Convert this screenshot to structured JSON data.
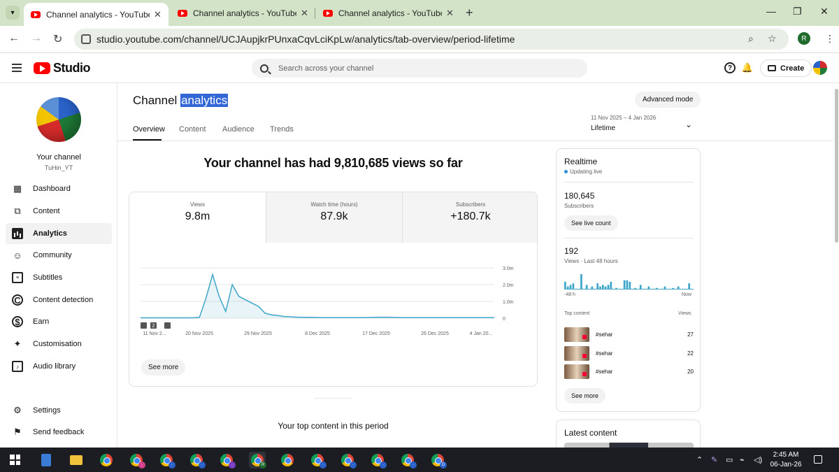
{
  "browser": {
    "tabs": [
      {
        "title": "Channel analytics - YouTube Studio",
        "active": true
      },
      {
        "title": "Channel analytics - YouTube Studio",
        "active": false
      },
      {
        "title": "Channel analytics - YouTube Studio",
        "active": false
      }
    ],
    "url": "studio.youtube.com/channel/UCJAupjkrPUnxaCqvLciKpLw/analytics/tab-overview/period-lifetime",
    "profile_initial": "R"
  },
  "header": {
    "logo_text": "Studio",
    "search_placeholder": "Search across your channel",
    "create_label": "Create"
  },
  "sidebar": {
    "channel_title": "Your channel",
    "channel_handle": "TuHin_YT",
    "items": [
      {
        "label": "Dashboard",
        "icon": "dashboard-icon"
      },
      {
        "label": "Content",
        "icon": "content-icon"
      },
      {
        "label": "Analytics",
        "icon": "analytics-icon",
        "active": true
      },
      {
        "label": "Community",
        "icon": "community-icon"
      },
      {
        "label": "Subtitles",
        "icon": "subtitles-icon"
      },
      {
        "label": "Content detection",
        "icon": "copyright-icon"
      },
      {
        "label": "Earn",
        "icon": "dollar-icon"
      },
      {
        "label": "Customisation",
        "icon": "magic-wand-icon"
      },
      {
        "label": "Audio library",
        "icon": "audio-library-icon"
      }
    ],
    "settings_label": "Settings",
    "feedback_label": "Send feedback"
  },
  "page": {
    "title_prefix": "Channel",
    "title_highlight": "analytics",
    "tabs": [
      "Overview",
      "Content",
      "Audience",
      "Trends"
    ],
    "advanced_mode_label": "Advanced mode",
    "date_range": "11 Nov 2025 – 4 Jan 2026",
    "period_label": "Lifetime",
    "headline": "Your channel has had 9,810,685 views so far",
    "metrics": [
      {
        "label": "Views",
        "value": "9.8m"
      },
      {
        "label": "Watch time (hours)",
        "value": "87.9k"
      },
      {
        "label": "Subscribers",
        "value": "+180.7k"
      }
    ],
    "see_more_label": "See more",
    "top_content_title": "Your top content in this period"
  },
  "chart_data": {
    "type": "area",
    "ylim": [
      0,
      3000000
    ],
    "y_ticks": [
      "0",
      "1.0m",
      "2.0m",
      "3.0m"
    ],
    "x_tick_labels": [
      "11 Nov 2...",
      "20 Nov 2025",
      "29 Nov 2025",
      "8 Dec 2025",
      "17 Dec 2025",
      "26 Dec 2025",
      "4 Jan 20..."
    ],
    "x": [
      0,
      1,
      2,
      3,
      4,
      5,
      6,
      7,
      8,
      9,
      10,
      11,
      12,
      13,
      14,
      15,
      16,
      17,
      18,
      19,
      20,
      21,
      22,
      23,
      24,
      25,
      26,
      27,
      28,
      29,
      30,
      31,
      32,
      33,
      34,
      35,
      36,
      37,
      38,
      39,
      40,
      41,
      42,
      43,
      44,
      45,
      46,
      47,
      48,
      49,
      50,
      51,
      52,
      53,
      54
    ],
    "values": [
      20000,
      20000,
      20000,
      20000,
      20000,
      20000,
      20000,
      20000,
      20000,
      50000,
      1200000,
      2600000,
      1300000,
      400000,
      2000000,
      1300000,
      1100000,
      900000,
      700000,
      300000,
      200000,
      150000,
      100000,
      80000,
      60000,
      50000,
      45000,
      40000,
      35000,
      30000,
      30000,
      30000,
      30000,
      30000,
      30000,
      40000,
      50000,
      60000,
      50000,
      40000,
      30000,
      30000,
      30000,
      30000,
      30000,
      30000,
      30000,
      30000,
      30000,
      30000,
      30000,
      30000,
      30000,
      30000,
      30000
    ],
    "markers": [
      "milestone-icon",
      "2",
      "milestone-icon"
    ],
    "color": "#3ea6c8"
  },
  "realtime": {
    "title": "Realtime",
    "status": "Updating live",
    "subscribers_value": "180,645",
    "subscribers_label": "Subscribers",
    "live_count_label": "See live count",
    "views_value": "192",
    "views_label": "Views · Last 48 hours",
    "bars": [
      5,
      2,
      3,
      4,
      0,
      0,
      10,
      0,
      3,
      0,
      2,
      0,
      4,
      2,
      3,
      2,
      3,
      5,
      0,
      1,
      0,
      0,
      6,
      6,
      5,
      0,
      1,
      0,
      3,
      0,
      0,
      2,
      0,
      0,
      1,
      0,
      0,
      2,
      0,
      0,
      1,
      0,
      2,
      0,
      0,
      0,
      4,
      0
    ],
    "axis_start": "-48 h",
    "axis_end": "Now",
    "top_content_label": "Top content",
    "views_col_label": "Views",
    "top_content": [
      {
        "title": "#sehar",
        "views": "27"
      },
      {
        "title": "#sehar",
        "views": "22"
      },
      {
        "title": "#sehar",
        "views": "20"
      }
    ],
    "see_more_label": "See more"
  },
  "latest": {
    "title": "Latest content"
  },
  "taskbar": {
    "time": "2:45 AM",
    "date": "06-Jan-26"
  }
}
